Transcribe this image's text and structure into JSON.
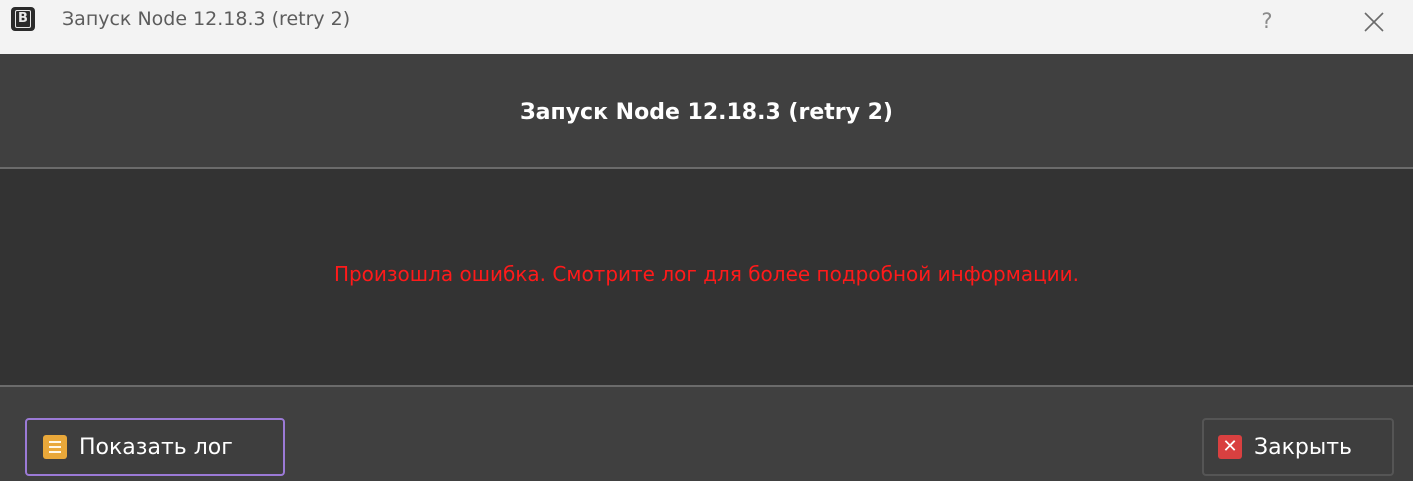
{
  "window": {
    "title": "Запуск Node 12.18.3 (retry 2)",
    "help_glyph": "?",
    "app_icon_letter": "B"
  },
  "header": {
    "title": "Запуск Node 12.18.3 (retry 2)"
  },
  "content": {
    "error_message": "Произошла ошибка. Смотрите лог для более подробной информации.",
    "error_color": "#ff1a1a"
  },
  "footer": {
    "show_log_label": "Показать лог",
    "close_label": "Закрыть",
    "close_glyph": "✕"
  },
  "icons": {
    "app": "app-logo-icon",
    "help": "help-icon",
    "close": "close-icon",
    "log": "log-list-icon",
    "close_button": "close-x-icon"
  },
  "colors": {
    "accent_border": "#9b7ad6",
    "log_icon": "#e9a83a",
    "close_icon": "#d94040"
  }
}
